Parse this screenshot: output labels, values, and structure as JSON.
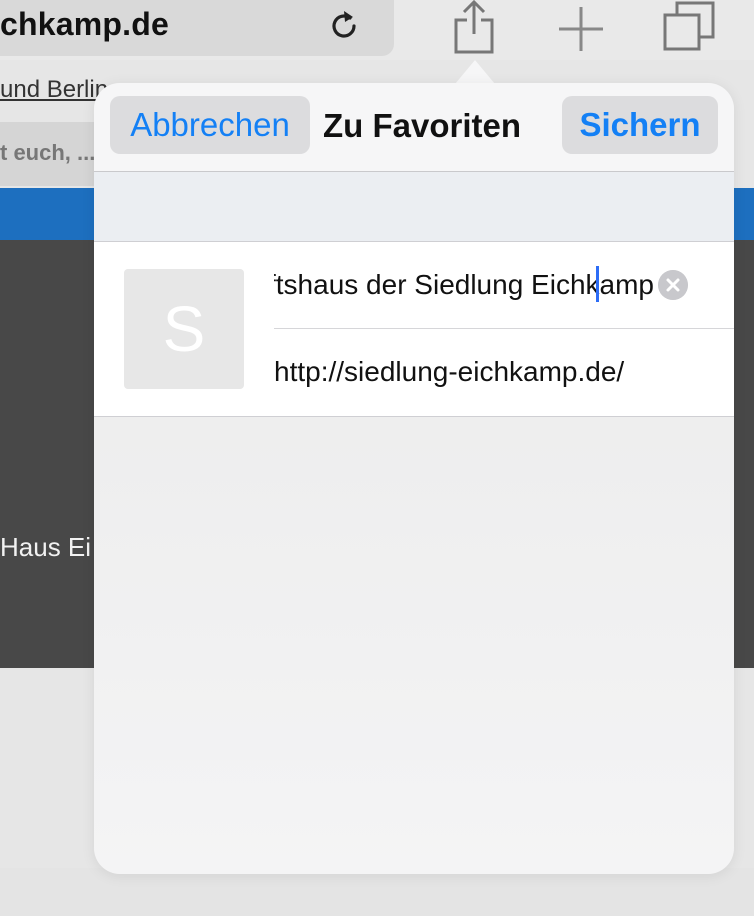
{
  "browser": {
    "url_display": "chkamp.de",
    "bookmark_link": "und Berlin - Haus Eichkamp - Stadt",
    "page_snippet": "t euch, ...",
    "hero_text": "Haus Ei"
  },
  "icons": {
    "reload": "reload-icon",
    "share": "share-icon",
    "new_tab": "plus-icon",
    "tabs": "tabs-icon",
    "clear": "clear-icon"
  },
  "dialog": {
    "title": "Zu Favoriten",
    "cancel_label": "Abbrechen",
    "save_label": "Sichern",
    "thumbnail_letter": "S",
    "title_value": "Siedlung Eichkamp - Das Gemeinschaftshaus der Siedlung Eichkamp",
    "url_value": "http://siedlung-eichkamp.de/"
  },
  "colors": {
    "accent": "#1480f5",
    "banner_blue": "#1d6fbf",
    "caret": "#2d6df6"
  }
}
